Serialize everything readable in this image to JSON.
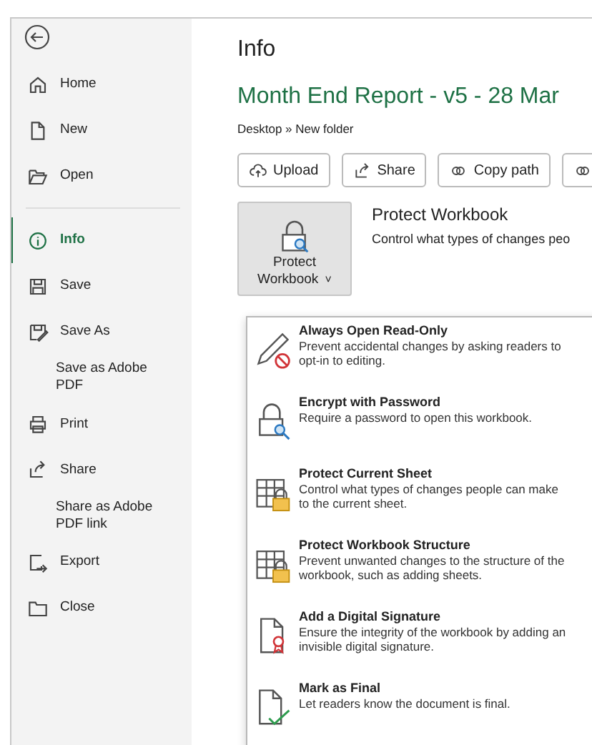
{
  "sidebar": {
    "groups": [
      [
        {
          "label": "Home",
          "selected": false
        },
        {
          "label": "New",
          "selected": false
        },
        {
          "label": "Open",
          "selected": false
        }
      ],
      [
        {
          "label": "Info",
          "selected": true
        },
        {
          "label": "Save",
          "selected": false
        },
        {
          "label": "Save As",
          "selected": false
        },
        {
          "label": "Save as Adobe PDF",
          "selected": false
        },
        {
          "label": "Print",
          "selected": false
        },
        {
          "label": "Share",
          "selected": false
        },
        {
          "label": "Share as Adobe PDF link",
          "selected": false
        },
        {
          "label": "Export",
          "selected": false
        },
        {
          "label": "Close",
          "selected": false
        }
      ]
    ]
  },
  "page_title": "Info",
  "document_title": "Month End Report - v5 - 28 Mar",
  "breadcrumb": "Desktop » New folder",
  "actions": [
    "Upload",
    "Share",
    "Copy path"
  ],
  "protect": {
    "button": "Protect Workbook",
    "caret": "˅",
    "heading": "Protect Workbook",
    "description": "Control what types of changes peo"
  },
  "menu": [
    {
      "title": "Always Open Read-Only",
      "description": "Prevent accidental changes by asking readers to opt-in to editing."
    },
    {
      "title": "Encrypt with Password",
      "description": "Require a password to open this workbook."
    },
    {
      "title": "Protect Current Sheet",
      "description": "Control what types of changes people can make to the current sheet."
    },
    {
      "title": "Protect Workbook Structure",
      "description": "Prevent unwanted changes to the structure of the workbook, such as adding sheets."
    },
    {
      "title": "Add a Digital Signature",
      "description": "Ensure the integrity of the workbook by adding an invisible digital signature."
    },
    {
      "title": "Mark as Final",
      "description": "Let readers know the document is final."
    }
  ]
}
